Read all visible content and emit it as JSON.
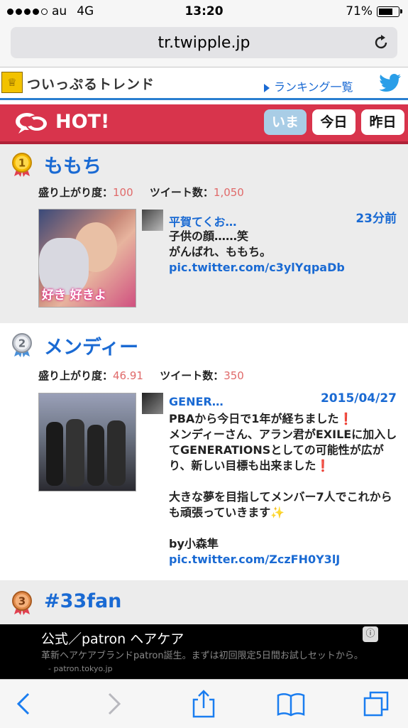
{
  "status": {
    "carrier": "au",
    "network": "4G",
    "time": "13:20",
    "battery": "71%"
  },
  "browser": {
    "url": "tr.twipple.jp"
  },
  "site": {
    "logo_text": "ついっぷるトレンド",
    "ranking_link": "ランキング一覧"
  },
  "hotbar": {
    "label": "HOT!",
    "tabs": [
      "いま",
      "今日",
      "昨日"
    ],
    "active_tab": "いま"
  },
  "entries": [
    {
      "rank": "1",
      "title": "ももち",
      "excitement_label": "盛り上がり度：",
      "excitement_value": "100",
      "tweets_label": "ツイート数：",
      "tweets_value": "1,050",
      "thumb_caption": "好き 好きよ",
      "tweet_user": "平賀てくお…",
      "tweet_time": "23分前",
      "tweet_lines": [
        "子供の顔……笑",
        "がんばれ、ももち。"
      ],
      "tweet_link": "pic.twitter.com/c3ylYqpaDb"
    },
    {
      "rank": "2",
      "title": "メンディー",
      "excitement_label": "盛り上がり度：",
      "excitement_value": "46.91",
      "tweets_label": "ツイート数：",
      "tweets_value": "350",
      "tweet_user": "GENER…",
      "tweet_time": "2015/04/27",
      "tweet_lines": [
        "PBAから今日で1年が経ちました❗",
        "メンディーさん、アラン君がEXILEに加入してGENERATIONSとしての可能性が広がり、新しい目標も出来ました❗",
        "",
        "大きな夢を目指してメンバー7人でこれからも頑張っていきます✨",
        "",
        "by小森隼"
      ],
      "tweet_link": "pic.twitter.com/ZczFH0Y3lJ"
    },
    {
      "rank": "3",
      "title": "#33fan"
    }
  ],
  "ad": {
    "title": "公式／patron ヘアケア",
    "desc": "革新ヘアケアブランドpatron誕生。まずは初回限定5日間お試しセットから。",
    "domain": "- patron.tokyo.jp"
  },
  "colors": {
    "accent_blue": "#1a6ad3",
    "hot_red": "#d8344c",
    "stat_pink": "#e06a6a"
  }
}
